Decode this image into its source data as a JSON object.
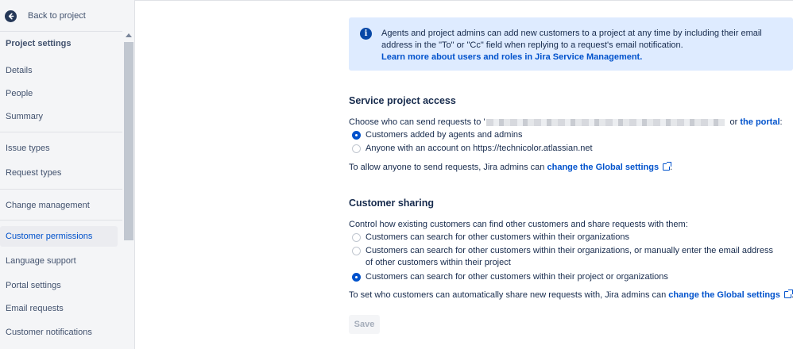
{
  "sidebar": {
    "back_label": "Back to project",
    "section_title": "Project settings",
    "items": [
      {
        "label": "Details"
      },
      {
        "label": "People"
      },
      {
        "label": "Summary"
      },
      {
        "label": "Issue types"
      },
      {
        "label": "Request types"
      },
      {
        "label": "Change management"
      },
      {
        "label": "Customer permissions"
      },
      {
        "label": "Language support"
      },
      {
        "label": "Portal settings"
      },
      {
        "label": "Email requests"
      },
      {
        "label": "Customer notifications"
      }
    ],
    "active_item": "Customer permissions"
  },
  "info_banner": {
    "text": "Agents and project admins can add new customers to a project at any time by including their email address in the \"To\" or \"Cc\" field when replying to a request's email notification.",
    "link": "Learn more about users and roles in Jira Service Management."
  },
  "service_access": {
    "heading": "Service project access",
    "intro_before": "Choose who can send requests to '",
    "intro_after": " or ",
    "portal_link": "the portal",
    "intro_end": ":",
    "options": [
      {
        "label": "Customers added by agents and admins",
        "checked": true
      },
      {
        "label": "Anyone with an account on https://technicolor.atlassian.net",
        "checked": false
      }
    ],
    "note_before": "To allow anyone to send requests, Jira admins can ",
    "note_link": "change the Global settings",
    "note_end": "."
  },
  "customer_sharing": {
    "heading": "Customer sharing",
    "intro": "Control how existing customers can find other customers and share requests with them:",
    "options": [
      {
        "label": "Customers can search for other customers within their organizations",
        "checked": false
      },
      {
        "label": "Customers can search for other customers within their organizations, or manually enter the email address of other customers within their project",
        "checked": false
      },
      {
        "label": "Customers can search for other customers within their project or organizations",
        "checked": true
      }
    ],
    "note_before": "To set who customers can automatically share new requests with, Jira admins can ",
    "note_link": "change the Global settings",
    "note_end": "."
  },
  "save_label": "Save",
  "colors": {
    "accent": "#0052cc",
    "info_bg": "#deebff",
    "sidebar_bg": "#f4f5f7"
  }
}
